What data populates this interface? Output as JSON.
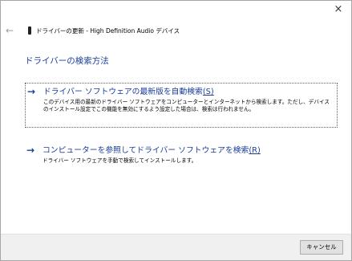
{
  "window": {
    "title": "ドライバーの更新 - High Definition Audio デバイス",
    "close_glyph": "×",
    "back_glyph": "←"
  },
  "heading": "ドライバーの検索方法",
  "options": [
    {
      "arrow": "→",
      "title": "ドライバー ソフトウェアの最新版を自動検索",
      "accelerator": "(S)",
      "description": "このデバイス用の最新のドライバー ソフトウェアをコンピューターとインターネットから検索します。ただし、デバイスのインストール設定でこの機能を無効にするよう設定した場合は、検索は行われません。"
    },
    {
      "arrow": "→",
      "title": "コンピューターを参照してドライバー ソフトウェアを検索",
      "accelerator": "(R)",
      "description": "ドライバー ソフトウェアを手動で検索してインストールします。"
    }
  ],
  "footer": {
    "cancel_label": "キャンセル"
  }
}
